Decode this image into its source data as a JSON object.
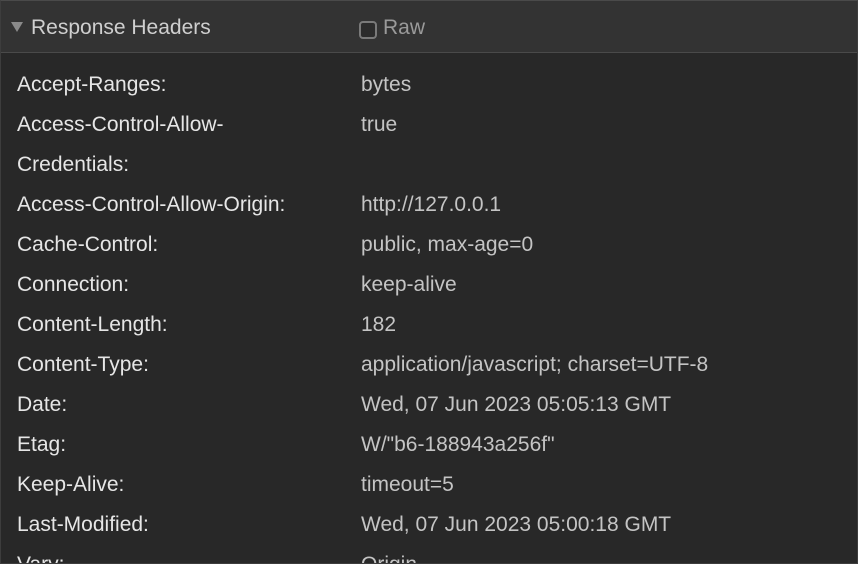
{
  "section": {
    "title": "Response Headers",
    "raw_label": "Raw",
    "raw_checked": false,
    "collapse_icon": "triangle-down-icon"
  },
  "headers": [
    {
      "key": "Accept-Ranges:",
      "value": "bytes"
    },
    {
      "key_line1": "Access-Control-Allow-",
      "key_line2": "Credentials:",
      "value": "true"
    },
    {
      "key": "Access-Control-Allow-Origin:",
      "value": "http://127.0.0.1"
    },
    {
      "key": "Cache-Control:",
      "value": "public, max-age=0"
    },
    {
      "key": "Connection:",
      "value": "keep-alive"
    },
    {
      "key": "Content-Length:",
      "value": "182"
    },
    {
      "key": "Content-Type:",
      "value": "application/javascript; charset=UTF-8"
    },
    {
      "key": "Date:",
      "value": "Wed, 07 Jun 2023 05:05:13 GMT"
    },
    {
      "key": "Etag:",
      "value": "W/\"b6-188943a256f\""
    },
    {
      "key": "Keep-Alive:",
      "value": "timeout=5"
    },
    {
      "key": "Last-Modified:",
      "value": "Wed, 07 Jun 2023 05:00:18 GMT"
    },
    {
      "key": "Vary:",
      "value": "Origin"
    }
  ],
  "colors": {
    "background": "#282828",
    "header_bg": "#333333",
    "key_text": "#e6e6e6",
    "value_text": "#c4c4c4"
  }
}
